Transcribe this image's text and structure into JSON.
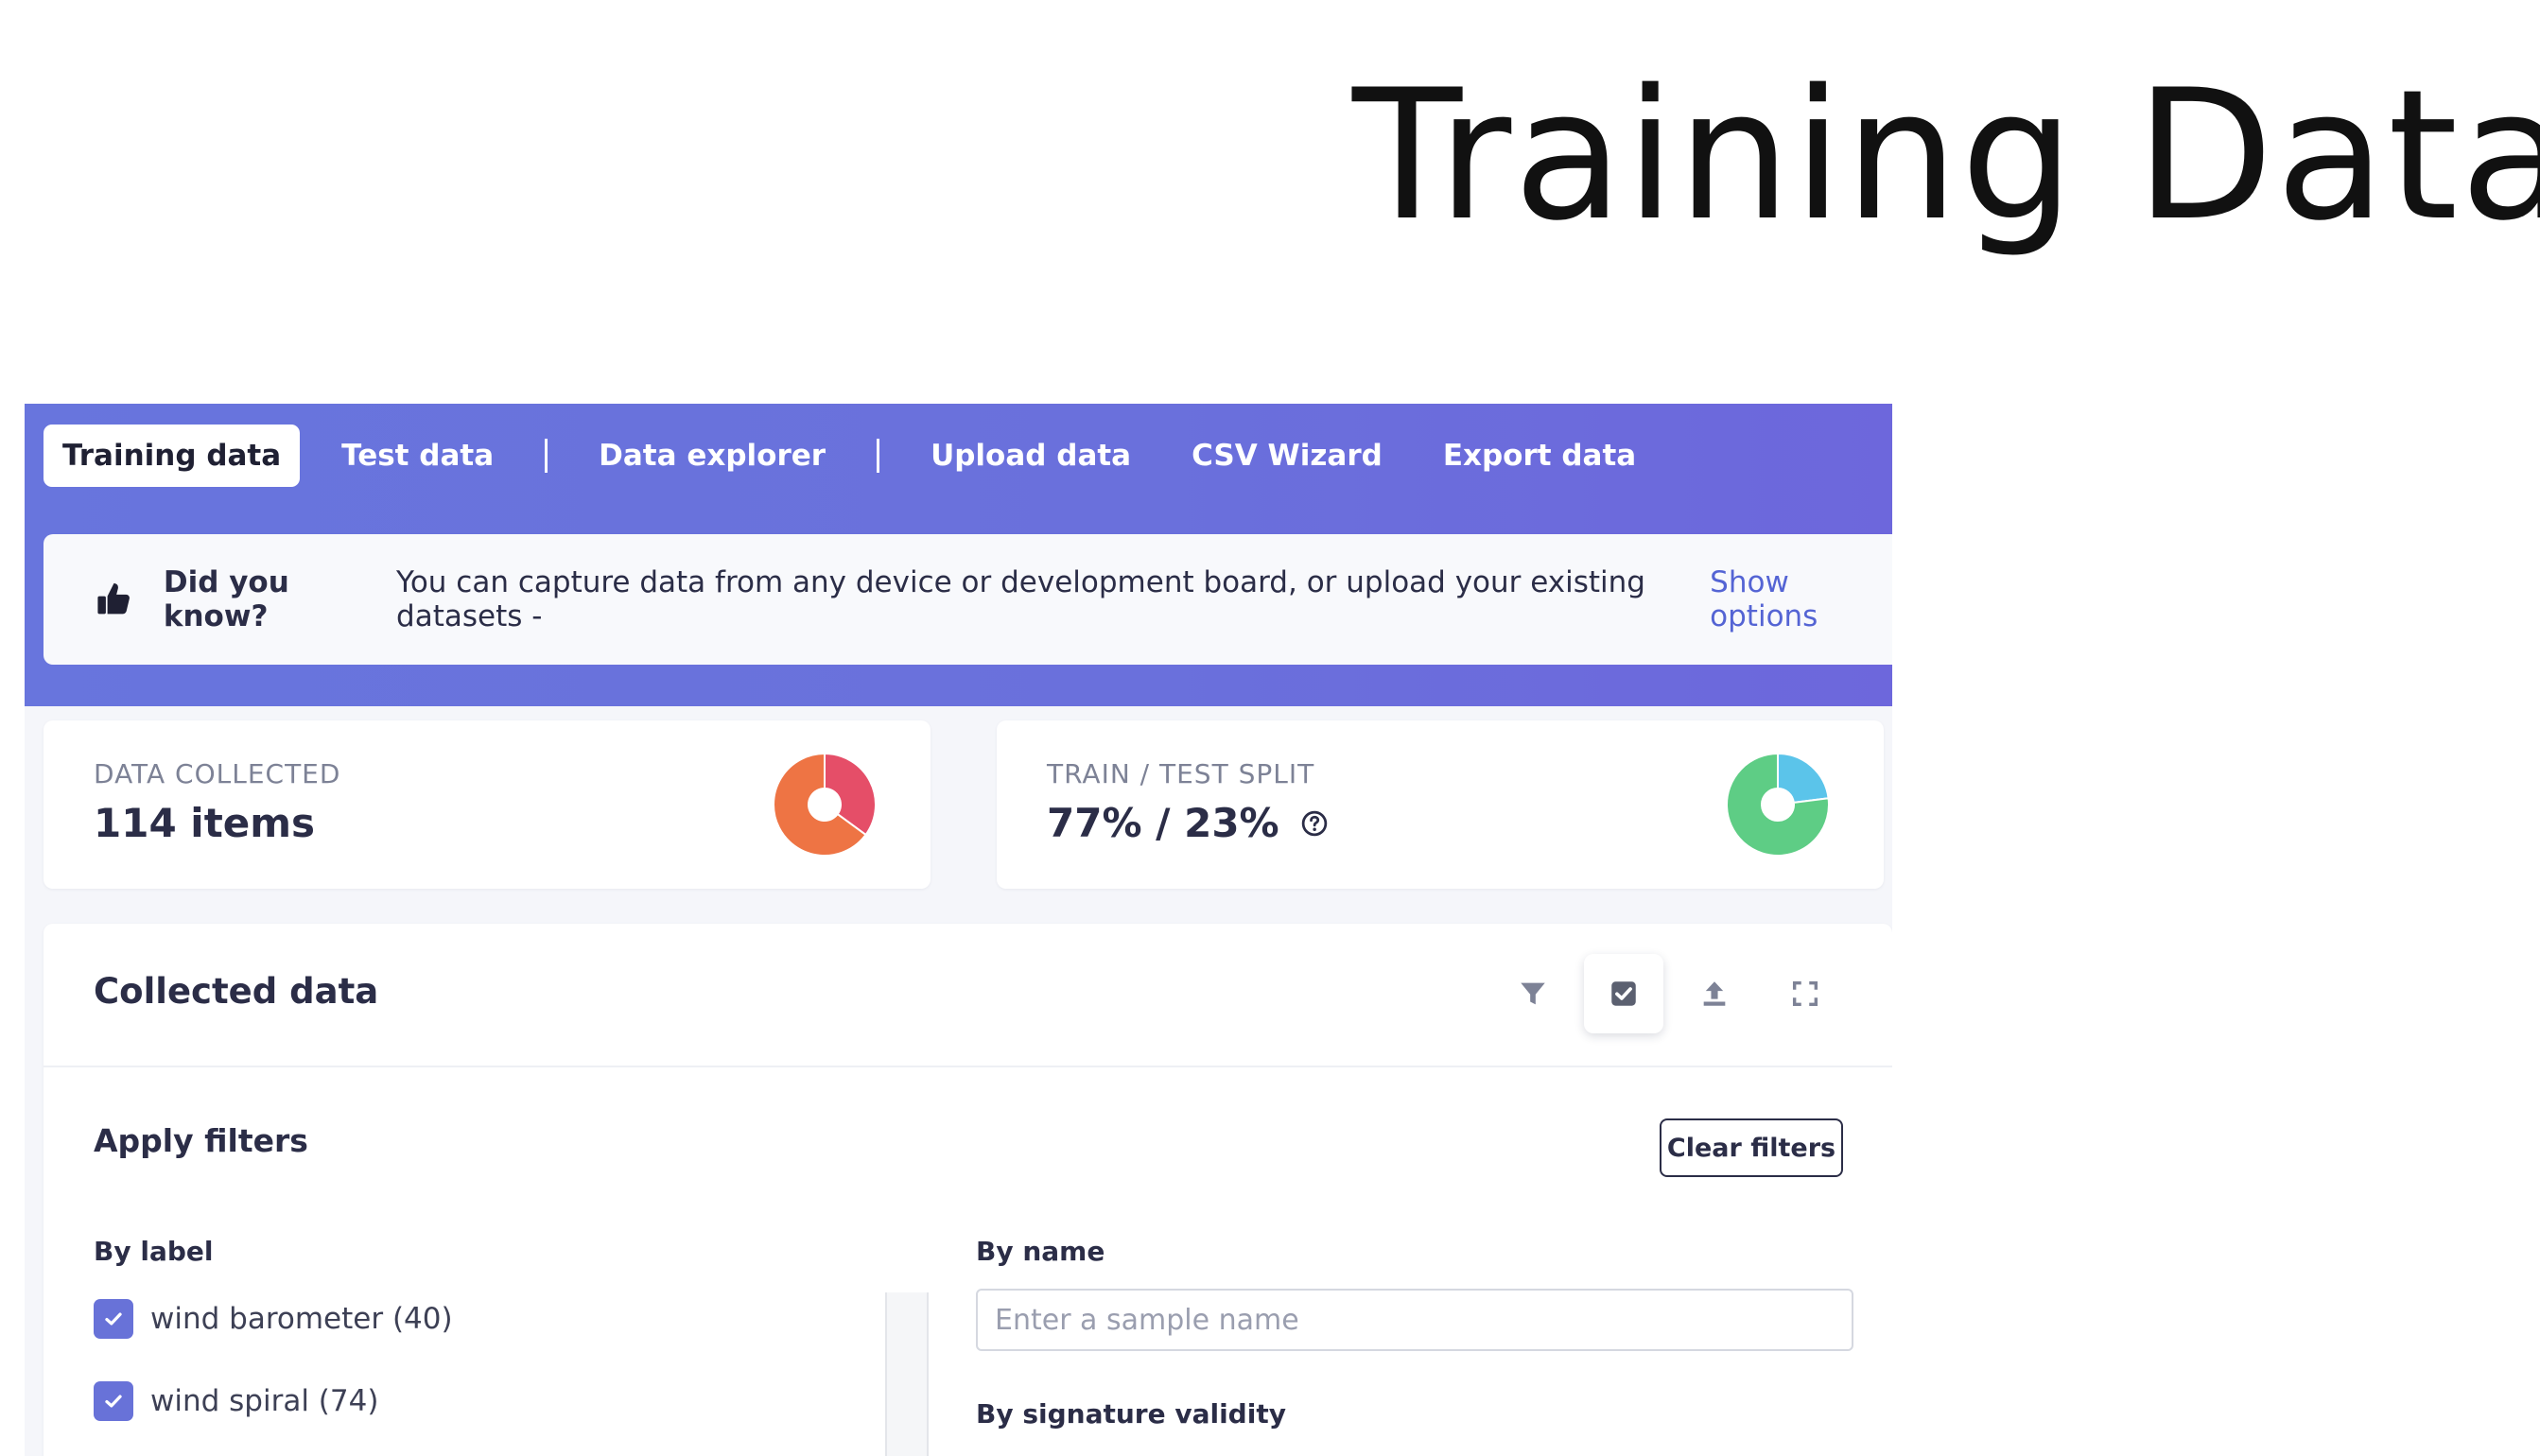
{
  "slide_title": "Training Data",
  "tabs": [
    {
      "label": "Training data",
      "active": true
    },
    {
      "label": "Test data",
      "active": false
    },
    {
      "label": "Data explorer",
      "active": false
    },
    {
      "label": "Upload data",
      "active": false
    },
    {
      "label": "CSV Wizard",
      "active": false
    },
    {
      "label": "Export data",
      "active": false
    }
  ],
  "tip": {
    "icon": "thumbs-up-icon",
    "bold": "Did you know?",
    "text": "You can capture data from any device or development board, or upload your existing datasets -",
    "link": "Show options"
  },
  "stats": {
    "collected": {
      "label": "DATA COLLECTED",
      "value": "114 items",
      "chart": {
        "type": "pie",
        "slices": [
          {
            "value": 40,
            "color": "#e54e68"
          },
          {
            "value": 74,
            "color": "#ee7444"
          }
        ]
      }
    },
    "split": {
      "label": "TRAIN / TEST SPLIT",
      "value": "77% / 23%",
      "help_icon": "question-circle-icon",
      "chart": {
        "type": "pie",
        "slices": [
          {
            "value": 23,
            "color": "#5bc4ea"
          },
          {
            "value": 77,
            "color": "#5ecd85"
          }
        ]
      }
    }
  },
  "collected": {
    "title": "Collected data",
    "tools": [
      "filter-icon",
      "checkbox-icon",
      "upload-icon",
      "expand-icon"
    ],
    "filters": {
      "title": "Apply filters",
      "clear_label": "Clear filters",
      "by_label": "By label",
      "labels": [
        {
          "text": "wind barometer (40)",
          "checked": true
        },
        {
          "text": "wind spiral (74)",
          "checked": true
        }
      ],
      "by_name": "By name",
      "name_placeholder": "Enter a sample name",
      "name_value": "",
      "by_signature": "By signature validity"
    }
  },
  "colors": {
    "accent": "#6a70dc",
    "text_dark": "#2b2d47",
    "link": "#5464d4",
    "checkbox": "#6872d8"
  }
}
